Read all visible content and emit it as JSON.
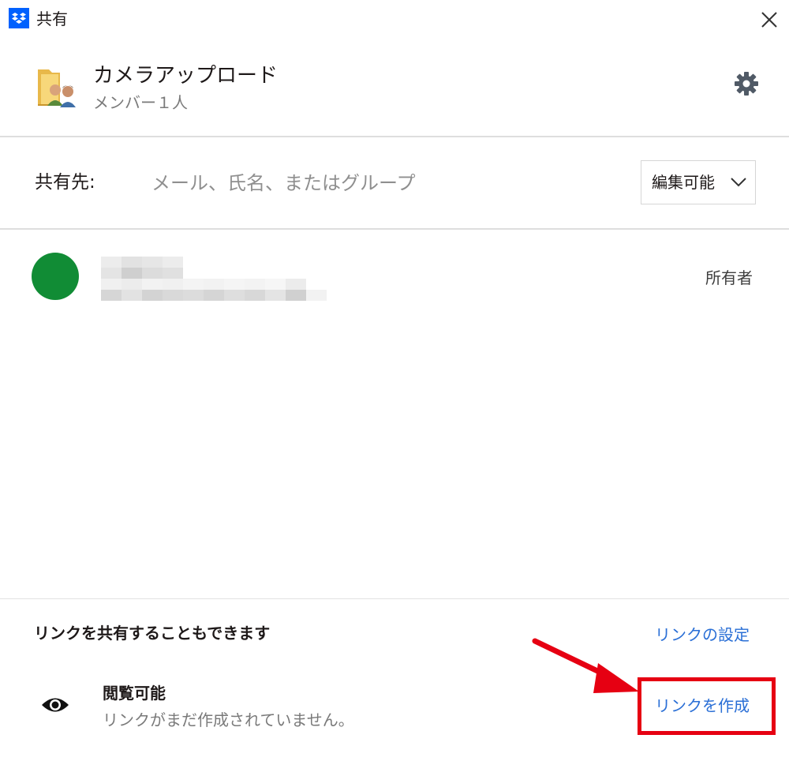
{
  "window": {
    "title": "共有",
    "logo_icon": "dropbox-logo-icon",
    "close_icon": "close-icon"
  },
  "folder": {
    "icon": "shared-folder-icon",
    "name": "カメラアップロード",
    "members": "メンバー１人",
    "settings_icon": "gear-icon"
  },
  "share": {
    "label": "共有先:",
    "placeholder": "メール、氏名、またはグループ",
    "value": "",
    "permission": "編集可能",
    "chevron_icon": "chevron-down-icon"
  },
  "members_list": [
    {
      "avatar_color": "#118c35",
      "name_obscured": true,
      "role": "所有者"
    }
  ],
  "link": {
    "heading": "リンクを共有することもできます",
    "settings_label": "リンクの設定",
    "access_title": "閲覧可能",
    "access_status": "リンクがまだ作成されていません。",
    "create_label": "リンクを作成",
    "eye_icon": "eye-icon"
  },
  "annotation": {
    "highlight_color": "#e60012",
    "arrow_icon": "red-arrow-icon"
  },
  "colors": {
    "brand": "#0061fe",
    "link": "#2a6fd6",
    "divider": "#dedede"
  }
}
